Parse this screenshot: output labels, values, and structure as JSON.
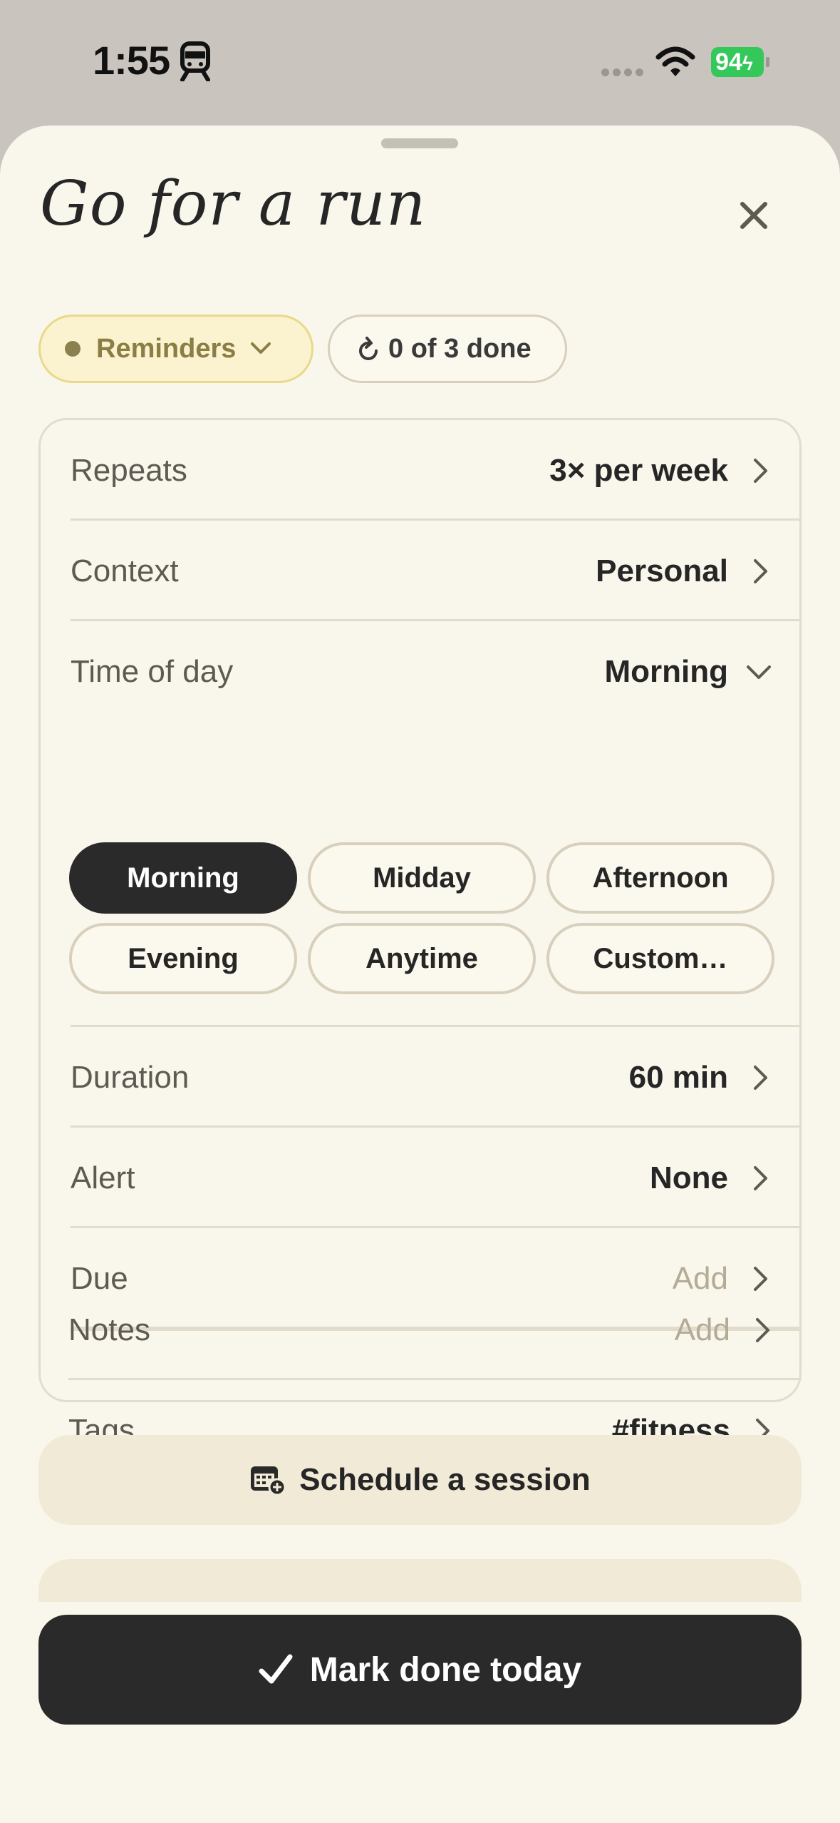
{
  "status": {
    "time": "1:55",
    "battery": "94"
  },
  "sheet": {
    "title": "Go for a run",
    "tag_pill": "Reminders",
    "progress_pill": "0 of 3 done"
  },
  "rows": {
    "repeats": {
      "label": "Repeats",
      "value": "3× per week"
    },
    "context": {
      "label": "Context",
      "value": "Personal"
    },
    "time_of_day": {
      "label": "Time of day",
      "value": "Morning",
      "options": [
        "Morning",
        "Midday",
        "Afternoon",
        "Evening",
        "Anytime",
        "Custom…"
      ],
      "selected": "Morning"
    },
    "duration": {
      "label": "Duration",
      "value": "60 min"
    },
    "alert": {
      "label": "Alert",
      "value": "None"
    },
    "due": {
      "label": "Due",
      "value": "Add"
    },
    "notes": {
      "label": "Notes",
      "value": "Add"
    },
    "tags": {
      "label": "Tags",
      "value": "#fitness"
    }
  },
  "actions": {
    "schedule": "Schedule a session",
    "mark_done": "Mark done today"
  },
  "colors": {
    "accent_dark": "#2a2a2a",
    "battery_green": "#34c759",
    "reminders_bg": "#fbf3cf"
  },
  "icons": [
    "train-icon",
    "wifi-icon",
    "battery-icon",
    "close-icon",
    "chevron-down-icon",
    "refresh-icon",
    "chevron-right-icon",
    "calendar-add-icon",
    "checkmark-icon"
  ]
}
